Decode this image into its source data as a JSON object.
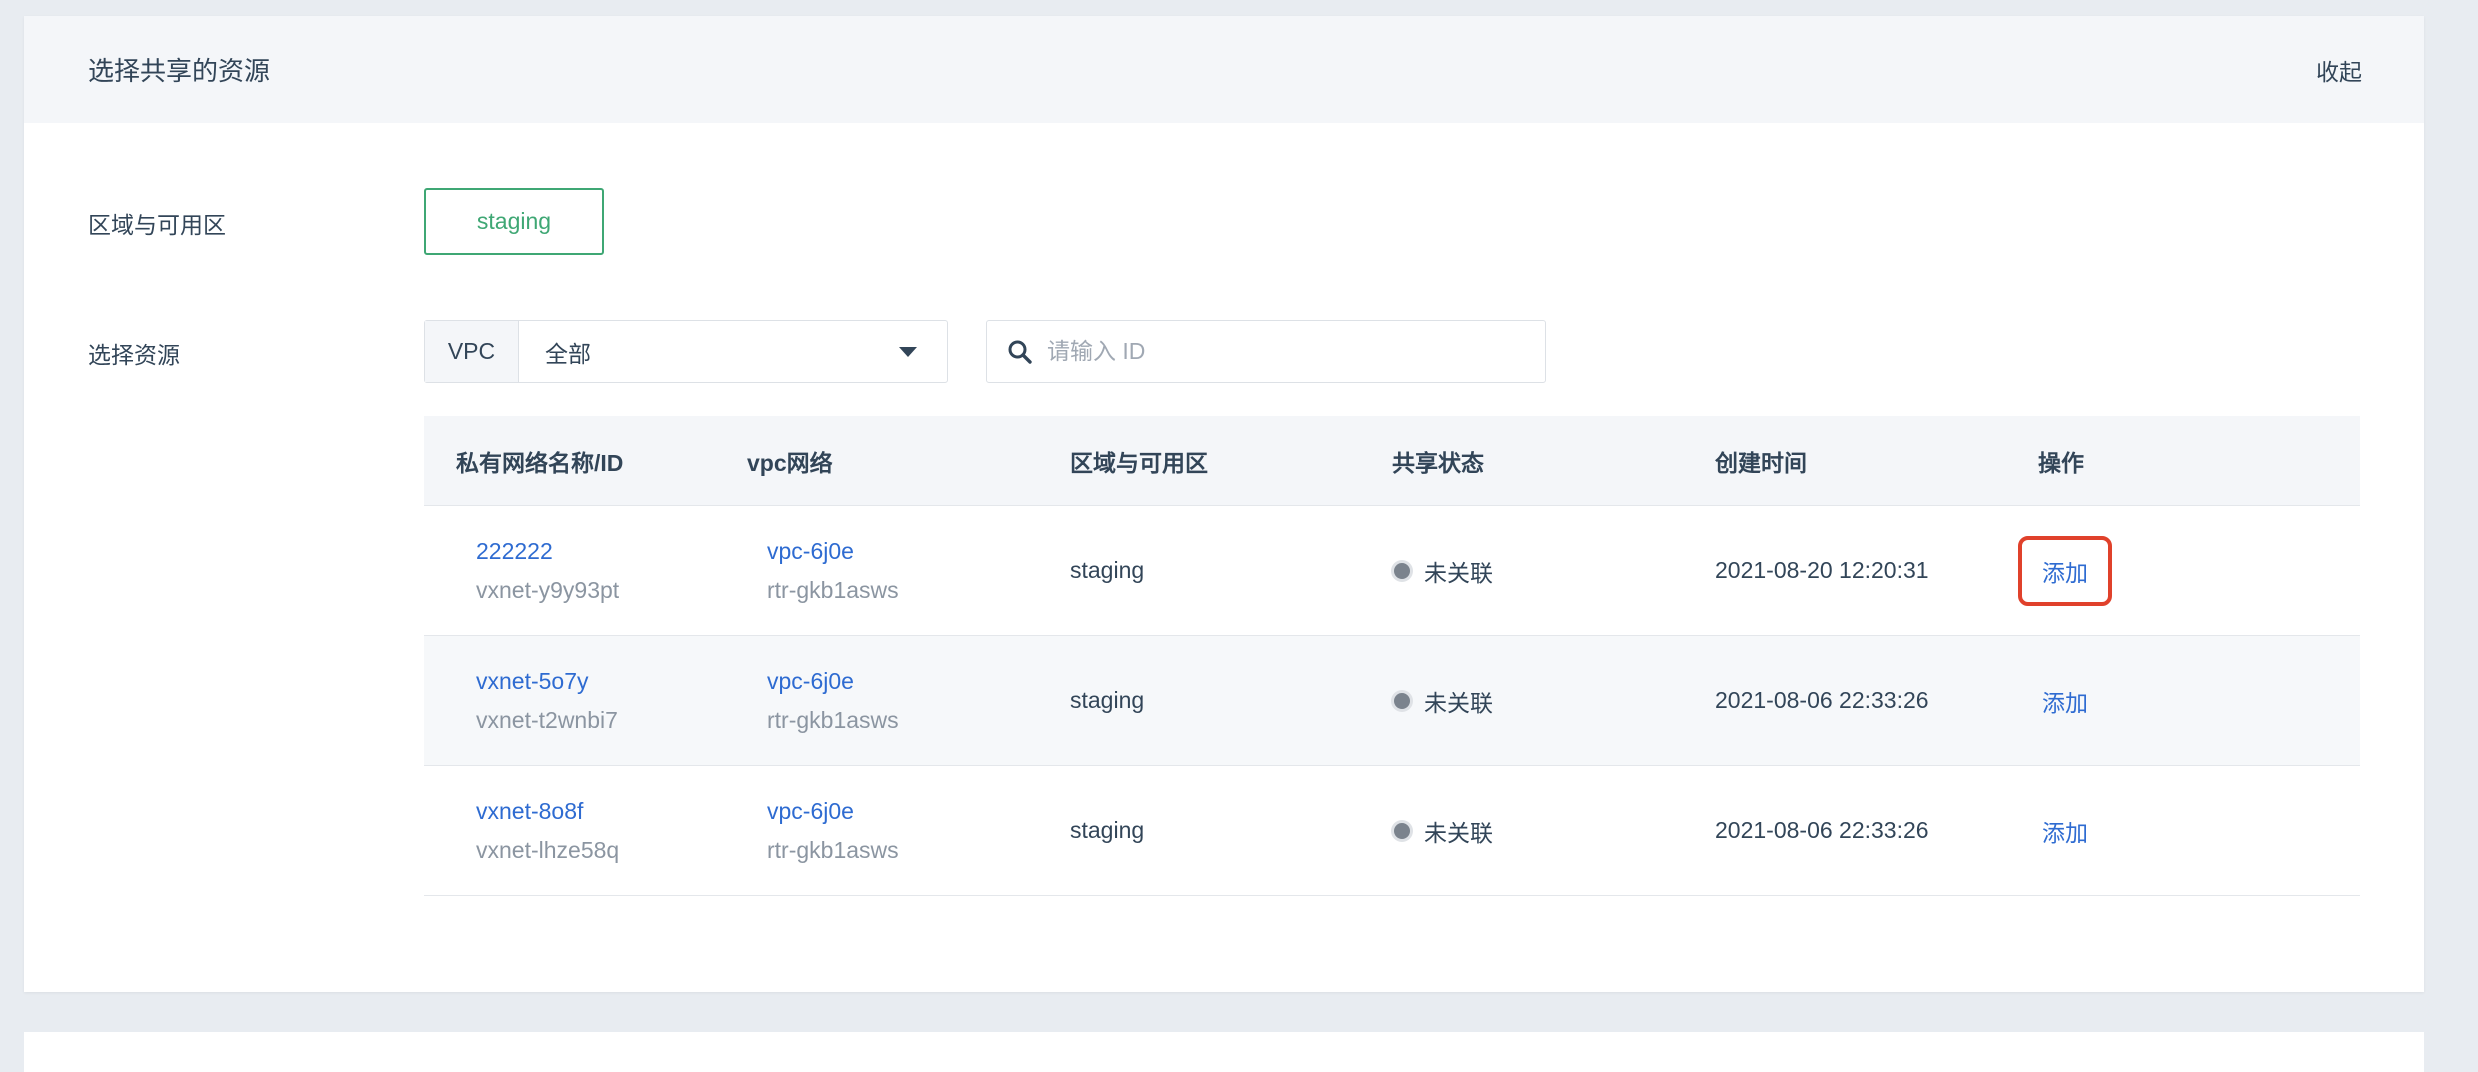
{
  "panel": {
    "title": "选择共享的资源",
    "collapse_label": "收起"
  },
  "zone": {
    "label": "区域与可用区",
    "selected": "staging"
  },
  "resource": {
    "label": "选择资源",
    "type_prefix": "VPC",
    "type_value": "全部",
    "search_placeholder": "请输入 ID"
  },
  "table": {
    "headers": [
      "私有网络名称/ID",
      "vpc网络",
      "区域与可用区",
      "共享状态",
      "创建时间",
      "操作"
    ],
    "rows": [
      {
        "name": "222222",
        "id": "vxnet-y9y93pt",
        "vpc": "vpc-6j0e",
        "router": "rtr-gkb1asws",
        "zone": "staging",
        "status": "未关联",
        "created": "2021-08-20 12:20:31",
        "action": "添加"
      },
      {
        "name": "vxnet-5o7y",
        "id": "vxnet-t2wnbi7",
        "vpc": "vpc-6j0e",
        "router": "rtr-gkb1asws",
        "zone": "staging",
        "status": "未关联",
        "created": "2021-08-06 22:33:26",
        "action": "添加"
      },
      {
        "name": "vxnet-8o8f",
        "id": "vxnet-lhze58q",
        "vpc": "vpc-6j0e",
        "router": "rtr-gkb1asws",
        "zone": "staging",
        "status": "未关联",
        "created": "2021-08-06 22:33:26",
        "action": "添加"
      }
    ]
  },
  "colors": {
    "accent_green": "#3fa774",
    "link_blue": "#2e6bd1",
    "highlight_red": "#e0412b"
  }
}
